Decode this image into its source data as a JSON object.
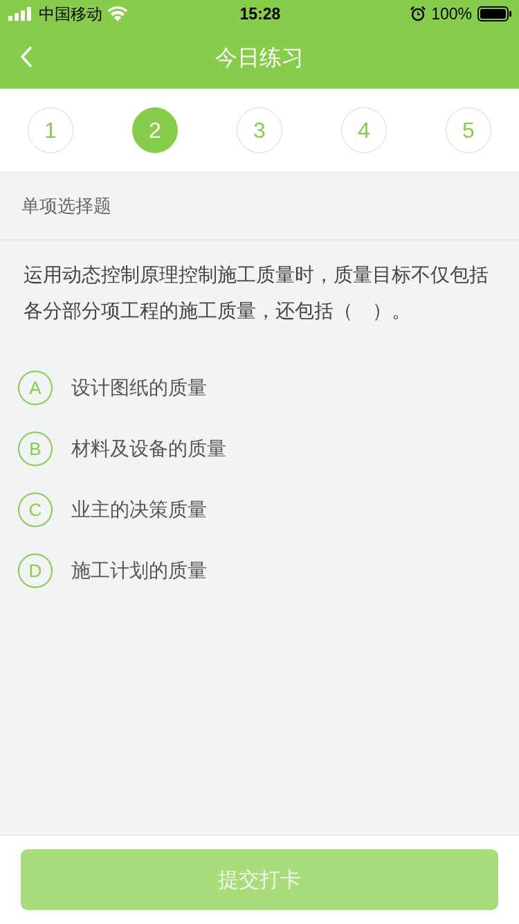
{
  "status_bar": {
    "carrier": "中国移动",
    "time": "15:28",
    "battery": "100%"
  },
  "nav": {
    "title": "今日练习"
  },
  "question_numbers": [
    {
      "label": "1",
      "selected": false
    },
    {
      "label": "2",
      "selected": true
    },
    {
      "label": "3",
      "selected": false
    },
    {
      "label": "4",
      "selected": false
    },
    {
      "label": "5",
      "selected": false
    }
  ],
  "section_title": "单项选择题",
  "question": "运用动态控制原理控制施工质量时，质量目标不仅包括各分部分项工程的施工质量，还包括（　）。",
  "options": [
    {
      "letter": "A",
      "text": "设计图纸的质量",
      "selected": false
    },
    {
      "letter": "B",
      "text": "材料及设备的质量",
      "selected": false
    },
    {
      "letter": "C",
      "text": "业主的决策质量",
      "selected": false
    },
    {
      "letter": "D",
      "text": "施工计划的质量",
      "selected": false
    }
  ],
  "submit_button": {
    "label": "提交打卡",
    "disabled": true
  }
}
